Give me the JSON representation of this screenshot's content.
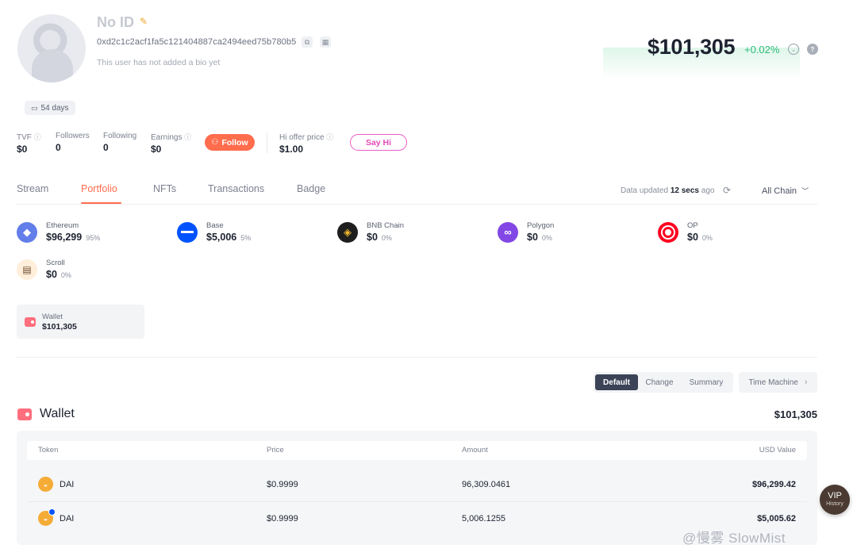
{
  "profile": {
    "name": "No ID",
    "address": "0xd2c1c2acf1fa5c121404887ca2494eed75b780b5",
    "bio": "This user has not added a bio yet",
    "days": "54 days"
  },
  "net_worth": {
    "value": "$101,305",
    "change": "+0.02%",
    "change_color": "#2dbe7a"
  },
  "stats": {
    "tvf_label": "TVF",
    "tvf_value": "$0",
    "followers_label": "Followers",
    "followers_value": "0",
    "following_label": "Following",
    "following_value": "0",
    "earnings_label": "Earnings",
    "earnings_value": "$0",
    "follow_btn": "Follow",
    "hi_offer_label": "Hi offer price",
    "hi_offer_value": "$1.00",
    "sayhi_btn": "Say Hi"
  },
  "tabs": [
    {
      "label": "Stream"
    },
    {
      "label": "Portfolio",
      "active": true
    },
    {
      "label": "NFTs"
    },
    {
      "label": "Transactions"
    },
    {
      "label": "Badge"
    }
  ],
  "update": {
    "prefix": "Data updated",
    "time": "12 secs",
    "suffix": "ago",
    "chain_filter": "All Chain"
  },
  "chains": [
    {
      "name": "Ethereum",
      "value": "$96,299",
      "pct": "95%",
      "color": "#627eea",
      "icon": "ethereum-icon"
    },
    {
      "name": "Base",
      "value": "$5,006",
      "pct": "5%",
      "color": "#0052ff",
      "icon": "base-icon"
    },
    {
      "name": "BNB Chain",
      "value": "$0",
      "pct": "0%",
      "color": "#1e1e1e",
      "icon": "bnb-icon"
    },
    {
      "name": "Polygon",
      "value": "$0",
      "pct": "0%",
      "color": "#8247e5",
      "icon": "polygon-icon"
    },
    {
      "name": "OP",
      "value": "$0",
      "pct": "0%",
      "color": "#ff0420",
      "icon": "op-icon"
    },
    {
      "name": "Scroll",
      "value": "$0",
      "pct": "0%",
      "color": "#ffeeda",
      "icon": "scroll-icon"
    }
  ],
  "wallet_card": {
    "label": "Wallet",
    "value": "$101,305"
  },
  "view_modes": {
    "default": "Default",
    "change": "Change",
    "summary": "Summary",
    "time_machine": "Time Machine"
  },
  "wallet_section": {
    "title": "Wallet",
    "total": "$101,305",
    "headers": {
      "token": "Token",
      "price": "Price",
      "amount": "Amount",
      "usd": "USD Value"
    },
    "rows": [
      {
        "token": "DAI",
        "price": "$0.9999",
        "amount": "96,309.0461",
        "usd": "$96,299.42"
      },
      {
        "token": "DAI",
        "price": "$0.9999",
        "amount": "5,006.1255",
        "usd": "$5,005.62"
      }
    ]
  },
  "vip": {
    "label": "VIP",
    "sub": "History"
  },
  "watermark": "@慢雾 SlowMist"
}
